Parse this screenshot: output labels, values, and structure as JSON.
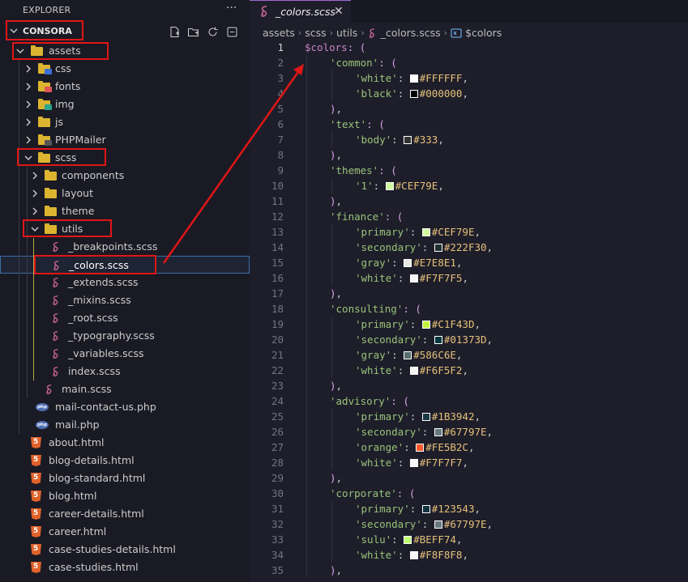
{
  "explorer": {
    "title": "EXPLORER",
    "more": "···",
    "root": "CONSORA",
    "actions": [
      "new-file-icon",
      "new-folder-icon",
      "refresh-icon",
      "collapse-all-icon"
    ]
  },
  "tree": [
    {
      "label": "assets",
      "icon": "folder-open-icon",
      "depth": 0,
      "chevron": "down"
    },
    {
      "label": "css",
      "icon": "folder-css-icon",
      "depth": 1,
      "chevron": "right",
      "badge": "CSS",
      "badge_color": "#3b6fd8"
    },
    {
      "label": "fonts",
      "icon": "folder-fonts-icon",
      "depth": 1,
      "chevron": "right",
      "badge": "A",
      "badge_color": "#e05555"
    },
    {
      "label": "img",
      "icon": "folder-img-icon",
      "depth": 1,
      "chevron": "right",
      "badge": "",
      "badge_color": "#2aa58f"
    },
    {
      "label": "js",
      "icon": "folder-js-icon",
      "depth": 1,
      "chevron": "right"
    },
    {
      "label": "PHPMailer",
      "icon": "folder-php-icon",
      "depth": 1,
      "chevron": "right",
      "badge": "PHP",
      "badge_color": "#555"
    },
    {
      "label": "scss",
      "icon": "folder-sass-icon",
      "depth": 1,
      "chevron": "down"
    },
    {
      "label": "components",
      "icon": "folder-components-icon",
      "depth": 2,
      "chevron": "right"
    },
    {
      "label": "layout",
      "icon": "folder-layout-icon",
      "depth": 2,
      "chevron": "right"
    },
    {
      "label": "theme",
      "icon": "folder-theme-icon",
      "depth": 2,
      "chevron": "right"
    },
    {
      "label": "utils",
      "icon": "folder-utils-icon",
      "depth": 2,
      "chevron": "down"
    },
    {
      "label": "_breakpoints.scss",
      "icon": "sass-file-icon",
      "depth": 3
    },
    {
      "label": "_colors.scss",
      "icon": "sass-file-icon",
      "depth": 3,
      "selected": true
    },
    {
      "label": "_extends.scss",
      "icon": "sass-file-icon",
      "depth": 3
    },
    {
      "label": "_mixins.scss",
      "icon": "sass-file-icon",
      "depth": 3
    },
    {
      "label": "_root.scss",
      "icon": "sass-file-icon",
      "depth": 3
    },
    {
      "label": "_typography.scss",
      "icon": "sass-file-icon",
      "depth": 3
    },
    {
      "label": "_variables.scss",
      "icon": "sass-file-icon",
      "depth": 3
    },
    {
      "label": "index.scss",
      "icon": "sass-file-icon",
      "depth": 3
    },
    {
      "label": "main.scss",
      "icon": "sass-file-icon",
      "depth": 2
    },
    {
      "label": "mail-contact-us.php",
      "icon": "php-file-icon",
      "depth": 1
    },
    {
      "label": "mail.php",
      "icon": "php-file-icon",
      "depth": 1
    },
    {
      "label": "about.html",
      "icon": "html-file-icon",
      "depth": 0
    },
    {
      "label": "blog-details.html",
      "icon": "html-file-icon",
      "depth": 0
    },
    {
      "label": "blog-standard.html",
      "icon": "html-file-icon",
      "depth": 0
    },
    {
      "label": "blog.html",
      "icon": "html-file-icon",
      "depth": 0
    },
    {
      "label": "career-details.html",
      "icon": "html-file-icon",
      "depth": 0
    },
    {
      "label": "career.html",
      "icon": "html-file-icon",
      "depth": 0
    },
    {
      "label": "case-studies-details.html",
      "icon": "html-file-icon",
      "depth": 0
    },
    {
      "label": "case-studies.html",
      "icon": "html-file-icon",
      "depth": 0
    }
  ],
  "editor": {
    "tab": {
      "label": "_colors.scss",
      "close": "✕"
    },
    "breadcrumb": [
      "assets",
      "scss",
      "utils",
      "_colors.scss",
      "$colors"
    ],
    "lines": [
      {
        "n": "1",
        "indent": 0,
        "parts": [
          [
            "var",
            "$colors"
          ],
          [
            "punc",
            ": ("
          ]
        ]
      },
      {
        "n": "2",
        "indent": 1,
        "parts": [
          [
            "str",
            "'common'"
          ],
          [
            "punc",
            ": ("
          ]
        ]
      },
      {
        "n": "3",
        "indent": 2,
        "parts": [
          [
            "str",
            "'white'"
          ],
          [
            "plain",
            ": "
          ],
          [
            "swatch",
            "#FFFFFF"
          ],
          [
            "col",
            "#FFFFFF"
          ],
          [
            "plain",
            ","
          ]
        ]
      },
      {
        "n": "4",
        "indent": 2,
        "parts": [
          [
            "str",
            "'black'"
          ],
          [
            "plain",
            ": "
          ],
          [
            "swatch",
            "#000000"
          ],
          [
            "col",
            "#000000"
          ],
          [
            "plain",
            ","
          ]
        ]
      },
      {
        "n": "5",
        "indent": 1,
        "parts": [
          [
            "punc",
            ")"
          ],
          [
            "plain",
            ","
          ]
        ]
      },
      {
        "n": "6",
        "indent": 1,
        "parts": [
          [
            "str",
            "'text'"
          ],
          [
            "punc",
            ": ("
          ]
        ]
      },
      {
        "n": "7",
        "indent": 2,
        "parts": [
          [
            "str",
            "'body'"
          ],
          [
            "plain",
            ": "
          ],
          [
            "swatch",
            "#333333"
          ],
          [
            "col",
            "#333"
          ],
          [
            "plain",
            ","
          ]
        ]
      },
      {
        "n": "8",
        "indent": 1,
        "parts": [
          [
            "punc",
            ")"
          ],
          [
            "plain",
            ","
          ]
        ]
      },
      {
        "n": "9",
        "indent": 1,
        "parts": [
          [
            "str",
            "'themes'"
          ],
          [
            "punc",
            ": ("
          ]
        ]
      },
      {
        "n": "10",
        "indent": 2,
        "parts": [
          [
            "str",
            "'1'"
          ],
          [
            "plain",
            ": "
          ],
          [
            "swatch",
            "#CEF79E"
          ],
          [
            "col",
            "#CEF79E"
          ],
          [
            "plain",
            ","
          ]
        ]
      },
      {
        "n": "11",
        "indent": 1,
        "parts": [
          [
            "punc",
            ")"
          ],
          [
            "plain",
            ","
          ]
        ]
      },
      {
        "n": "12",
        "indent": 1,
        "parts": [
          [
            "str",
            "'finance'"
          ],
          [
            "punc",
            ": ("
          ]
        ]
      },
      {
        "n": "13",
        "indent": 2,
        "parts": [
          [
            "str",
            "'primary'"
          ],
          [
            "plain",
            ": "
          ],
          [
            "swatch",
            "#CEF79E"
          ],
          [
            "col",
            "#CEF79E"
          ],
          [
            "plain",
            ","
          ]
        ]
      },
      {
        "n": "14",
        "indent": 2,
        "parts": [
          [
            "str",
            "'secondary'"
          ],
          [
            "plain",
            ": "
          ],
          [
            "swatch",
            "#222F30"
          ],
          [
            "col",
            "#222F30"
          ],
          [
            "plain",
            ","
          ]
        ]
      },
      {
        "n": "15",
        "indent": 2,
        "parts": [
          [
            "str",
            "'gray'"
          ],
          [
            "plain",
            ": "
          ],
          [
            "swatch",
            "#E7E8E1"
          ],
          [
            "col",
            "#E7E8E1"
          ],
          [
            "plain",
            ","
          ]
        ]
      },
      {
        "n": "16",
        "indent": 2,
        "parts": [
          [
            "str",
            "'white'"
          ],
          [
            "plain",
            ": "
          ],
          [
            "swatch",
            "#F7F7F5"
          ],
          [
            "col",
            "#F7F7F5"
          ],
          [
            "plain",
            ","
          ]
        ]
      },
      {
        "n": "17",
        "indent": 1,
        "parts": [
          [
            "punc",
            ")"
          ],
          [
            "plain",
            ","
          ]
        ]
      },
      {
        "n": "18",
        "indent": 1,
        "parts": [
          [
            "str",
            "'consulting'"
          ],
          [
            "punc",
            ": ("
          ]
        ]
      },
      {
        "n": "19",
        "indent": 2,
        "parts": [
          [
            "str",
            "'primary'"
          ],
          [
            "plain",
            ": "
          ],
          [
            "swatch",
            "#C1F43D"
          ],
          [
            "col",
            "#C1F43D"
          ],
          [
            "plain",
            ","
          ]
        ]
      },
      {
        "n": "20",
        "indent": 2,
        "parts": [
          [
            "str",
            "'secondary'"
          ],
          [
            "plain",
            ": "
          ],
          [
            "swatch",
            "#01373D"
          ],
          [
            "col",
            "#01373D"
          ],
          [
            "plain",
            ","
          ]
        ]
      },
      {
        "n": "21",
        "indent": 2,
        "parts": [
          [
            "str",
            "'gray'"
          ],
          [
            "plain",
            ": "
          ],
          [
            "swatch",
            "#586C6E"
          ],
          [
            "col",
            "#586C6E"
          ],
          [
            "plain",
            ","
          ]
        ]
      },
      {
        "n": "22",
        "indent": 2,
        "parts": [
          [
            "str",
            "'white'"
          ],
          [
            "plain",
            ": "
          ],
          [
            "swatch",
            "#F6F5F2"
          ],
          [
            "col",
            "#F6F5F2"
          ],
          [
            "plain",
            ","
          ]
        ]
      },
      {
        "n": "23",
        "indent": 1,
        "parts": [
          [
            "punc",
            ")"
          ],
          [
            "plain",
            ","
          ]
        ]
      },
      {
        "n": "24",
        "indent": 1,
        "parts": [
          [
            "str",
            "'advisory'"
          ],
          [
            "punc",
            ": ("
          ]
        ]
      },
      {
        "n": "25",
        "indent": 2,
        "parts": [
          [
            "str",
            "'primary'"
          ],
          [
            "plain",
            ": "
          ],
          [
            "swatch",
            "#1B3942"
          ],
          [
            "col",
            "#1B3942"
          ],
          [
            "plain",
            ","
          ]
        ]
      },
      {
        "n": "26",
        "indent": 2,
        "parts": [
          [
            "str",
            "'secondary'"
          ],
          [
            "plain",
            ": "
          ],
          [
            "swatch",
            "#67797E"
          ],
          [
            "col",
            "#67797E"
          ],
          [
            "plain",
            ","
          ]
        ]
      },
      {
        "n": "27",
        "indent": 2,
        "parts": [
          [
            "str",
            "'orange'"
          ],
          [
            "plain",
            ": "
          ],
          [
            "swatch",
            "#FE5B2C"
          ],
          [
            "col",
            "#FE5B2C"
          ],
          [
            "plain",
            ","
          ]
        ]
      },
      {
        "n": "28",
        "indent": 2,
        "parts": [
          [
            "str",
            "'white'"
          ],
          [
            "plain",
            ": "
          ],
          [
            "swatch",
            "#F7F7F7"
          ],
          [
            "col",
            "#F7F7F7"
          ],
          [
            "plain",
            ","
          ]
        ]
      },
      {
        "n": "29",
        "indent": 1,
        "parts": [
          [
            "punc",
            ")"
          ],
          [
            "plain",
            ","
          ]
        ]
      },
      {
        "n": "30",
        "indent": 1,
        "parts": [
          [
            "str",
            "'corporate'"
          ],
          [
            "punc",
            ": ("
          ]
        ]
      },
      {
        "n": "31",
        "indent": 2,
        "parts": [
          [
            "str",
            "'primary'"
          ],
          [
            "plain",
            ": "
          ],
          [
            "swatch",
            "#123543"
          ],
          [
            "col",
            "#123543"
          ],
          [
            "plain",
            ","
          ]
        ]
      },
      {
        "n": "32",
        "indent": 2,
        "parts": [
          [
            "str",
            "'secondary'"
          ],
          [
            "plain",
            ": "
          ],
          [
            "swatch",
            "#67797E"
          ],
          [
            "col",
            "#67797E"
          ],
          [
            "plain",
            ","
          ]
        ]
      },
      {
        "n": "33",
        "indent": 2,
        "parts": [
          [
            "str",
            "'sulu'"
          ],
          [
            "plain",
            ": "
          ],
          [
            "swatch",
            "#BEFF74"
          ],
          [
            "col",
            "#BEFF74"
          ],
          [
            "plain",
            ","
          ]
        ]
      },
      {
        "n": "34",
        "indent": 2,
        "parts": [
          [
            "str",
            "'white'"
          ],
          [
            "plain",
            ": "
          ],
          [
            "swatch",
            "#F8F8F8"
          ],
          [
            "col",
            "#F8F8F8"
          ],
          [
            "plain",
            ","
          ]
        ]
      },
      {
        "n": "35",
        "indent": 1,
        "parts": [
          [
            "punc",
            ")"
          ],
          [
            "plain",
            ","
          ]
        ]
      }
    ]
  },
  "colors": {
    "accent_red": "#e01616",
    "sass_pink": "#cd6799",
    "folder_yellow": "#dcb430"
  }
}
